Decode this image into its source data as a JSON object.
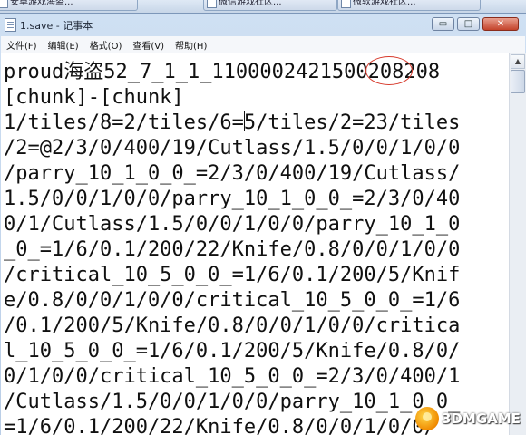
{
  "taskbar": {
    "tabs": [
      {
        "label": "安卓游戏海盗..."
      },
      {
        "label": "微信游戏社区..."
      },
      {
        "label": "微软游戏社区..."
      }
    ]
  },
  "window": {
    "title": "1.save - 记事本",
    "controls": {
      "minimize": "▭",
      "maximize": "□",
      "close": "✕"
    }
  },
  "menu": {
    "items": [
      "文件(F)",
      "编辑(E)",
      "格式(O)",
      "查看(V)",
      "帮助(H)"
    ]
  },
  "editor": {
    "lines": [
      "proud海盗52_7_1_1_1100002421500208208",
      "[chunk]-[chunk]",
      "1/tiles/8=2/tiles/6=5/tiles/2=23/tiles",
      "/2=@2/3/0/400/19/Cutlass/1.5/0/0/1/0/0",
      "/parry_10_1_0_0_=2/3/0/400/19/Cutlass/",
      "1.5/0/0/1/0/0/parry_10_1_0_0_=2/3/0/40",
      "0/1/Cutlass/1.5/0/0/1/0/0/parry_10_1_0",
      "_0_=1/6/0.1/200/22/Knife/0.8/0/0/1/0/0",
      "/critical_10_5_0_0_=1/6/0.1/200/5/Knif",
      "e/0.8/0/0/1/0/0/critical_10_5_0_0_=1/6",
      "/0.1/200/5/Knife/0.8/0/0/1/0/0/critica",
      "l_10_5_0_0_=1/6/0.1/200/5/Knife/0.8/0/",
      "0/1/0/0/critical_10_5_0_0_=2/3/0/400/1",
      "/Cutlass/1.5/0/0/1/0/0/parry_10_1_0_0_",
      "=1/6/0.1/200/22/Knife/0.8/0/0/1/0/0/"
    ],
    "caret_line": 2,
    "highlighted_value": "500",
    "annotation_color": "#d73a2c"
  },
  "watermark": {
    "text": "3DMGAME",
    "icon": "3dm-logo-icon"
  }
}
